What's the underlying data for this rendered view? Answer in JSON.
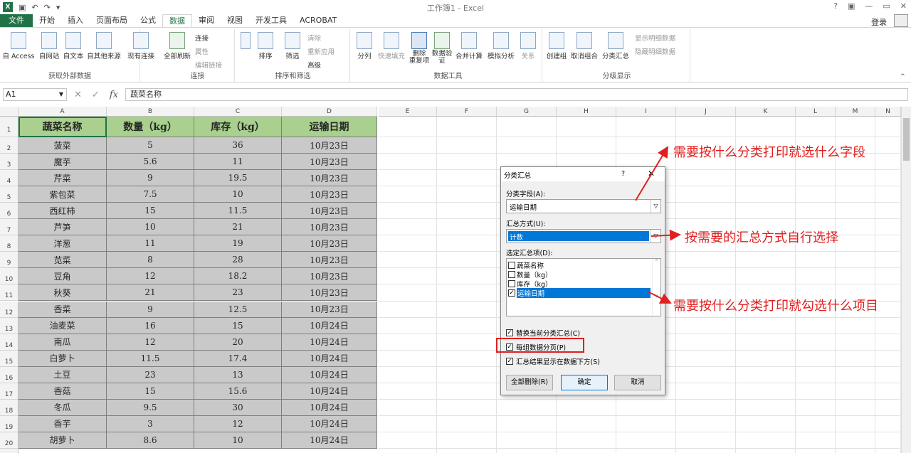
{
  "window": {
    "title": "工作簿1 - Excel",
    "help": "?",
    "restore_ribbon": "▣",
    "minimize": "—",
    "maximize": "▭",
    "close": "✕"
  },
  "menu": {
    "tabs": [
      "文件",
      "开始",
      "插入",
      "页面布局",
      "公式",
      "数据",
      "审阅",
      "视图",
      "开发工具",
      "ACROBAT"
    ],
    "active": "数据",
    "login": "登录"
  },
  "ribbon": {
    "get_external": {
      "label": "获取外部数据",
      "buttons": [
        "自 Access",
        "自网站",
        "自文本",
        "自其他来源",
        "现有连接"
      ]
    },
    "connections": {
      "label": "连接",
      "refresh": "全部刷新",
      "items": [
        "连接",
        "属性",
        "编辑链接"
      ]
    },
    "sort_filter": {
      "label": "排序和筛选",
      "sort": "排序",
      "filter": "筛选",
      "items": [
        "清除",
        "重新应用",
        "高级"
      ]
    },
    "data_tools": {
      "label": "数据工具",
      "buttons": [
        "分列",
        "快速填充",
        "删除\n重复项",
        "数据验\n证",
        "合并计算",
        "模拟分析",
        "关系"
      ]
    },
    "outline": {
      "label": "分级显示",
      "buttons": [
        "创建组",
        "取消组合",
        "分类汇总"
      ],
      "items": [
        "显示明细数据",
        "隐藏明细数据"
      ]
    }
  },
  "formula_bar": {
    "name_box": "A1",
    "content": "蔬菜名称",
    "fx": "fx"
  },
  "sheet": {
    "columns": [
      "A",
      "B",
      "C",
      "D",
      "E",
      "F",
      "G",
      "H",
      "I",
      "J",
      "K",
      "L",
      "M",
      "N"
    ],
    "header": [
      "蔬菜名称",
      "数量（kg）",
      "库存（kg）",
      "运输日期"
    ],
    "rows": [
      [
        "菠菜",
        "5",
        "36",
        "10月23日"
      ],
      [
        "魔芋",
        "5.6",
        "11",
        "10月23日"
      ],
      [
        "芹菜",
        "9",
        "19.5",
        "10月23日"
      ],
      [
        "紫包菜",
        "7.5",
        "10",
        "10月23日"
      ],
      [
        "西红柿",
        "15",
        "11.5",
        "10月23日"
      ],
      [
        "芦笋",
        "10",
        "21",
        "10月23日"
      ],
      [
        "洋葱",
        "11",
        "19",
        "10月23日"
      ],
      [
        "苋菜",
        "8",
        "28",
        "10月23日"
      ],
      [
        "豆角",
        "12",
        "18.2",
        "10月23日"
      ],
      [
        "秋葵",
        "21",
        "23",
        "10月23日"
      ],
      [
        "香菜",
        "9",
        "12.5",
        "10月23日"
      ],
      [
        "油麦菜",
        "16",
        "15",
        "10月24日"
      ],
      [
        "南瓜",
        "12",
        "20",
        "10月24日"
      ],
      [
        "白萝卜",
        "11.5",
        "17.4",
        "10月24日"
      ],
      [
        "土豆",
        "23",
        "13",
        "10月24日"
      ],
      [
        "香菇",
        "15",
        "15.6",
        "10月24日"
      ],
      [
        "冬瓜",
        "9.5",
        "30",
        "10月24日"
      ],
      [
        "香芋",
        "3",
        "12",
        "10月24日"
      ],
      [
        "胡萝卜",
        "8.6",
        "10",
        "10月24日"
      ]
    ],
    "row_numbers": [
      "1",
      "2",
      "3",
      "4",
      "5",
      "6",
      "7",
      "8",
      "9",
      "10",
      "11",
      "12",
      "13",
      "14",
      "15",
      "16",
      "17",
      "18",
      "19",
      "20"
    ]
  },
  "dialog": {
    "title": "分类汇总",
    "help": "?",
    "close": "✕",
    "group_field_label": "分类字段(A):",
    "group_field_value": "运输日期",
    "function_label": "汇总方式(U):",
    "function_value": "计数",
    "items_label": "选定汇总项(D):",
    "items": [
      {
        "label": "蔬菜名称",
        "checked": false
      },
      {
        "label": "数量（kg）",
        "checked": false
      },
      {
        "label": "库存（kg）",
        "checked": false
      },
      {
        "label": "运输日期",
        "checked": true
      }
    ],
    "options": [
      "替换当前分类汇总(C)",
      "每组数据分页(P)",
      "汇总结果显示在数据下方(S)"
    ],
    "buttons": {
      "remove_all": "全部删除(R)",
      "ok": "确定",
      "cancel": "取消"
    }
  },
  "annotations": [
    "需要按什么分类打印就选什么字段",
    "按需要的汇总方式自行选择",
    "需要按什么分类打印就勾选什么项目"
  ],
  "colors": {
    "excel_green": "#217346",
    "header_fill": "#a9d08e",
    "data_fill": "#c9c9c9",
    "annotation_red": "#e02020",
    "selection_blue": "#0078d7"
  }
}
